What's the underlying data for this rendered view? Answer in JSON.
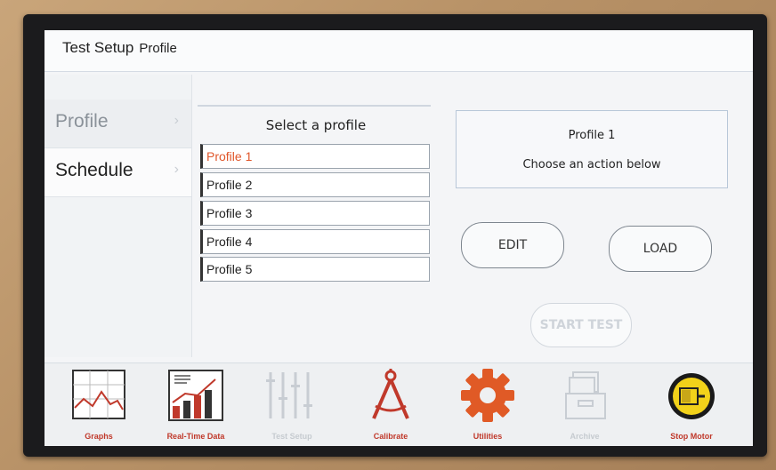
{
  "header": {
    "title": "Test Setup",
    "subtitle": "Profile"
  },
  "sidebar": {
    "items": [
      {
        "label": "Profile",
        "state": "active"
      },
      {
        "label": "Schedule",
        "state": "normal"
      }
    ]
  },
  "profiles": {
    "title": "Select a profile",
    "items": [
      "Profile 1",
      "Profile 2",
      "Profile 3",
      "Profile 4",
      "Profile 5"
    ],
    "selected": "Profile 1"
  },
  "info": {
    "line1": "Profile 1",
    "line2": "Choose an action below"
  },
  "actions": {
    "edit": "EDIT",
    "load": "LOAD",
    "start": "START TEST"
  },
  "toolbar": {
    "graphs": "Graphs",
    "realtime": "Real-Time Data",
    "testsetup": "Test Setup",
    "calibrate": "Calibrate",
    "utilities": "Utilities",
    "archive": "Archive",
    "stopmotor": "Stop Motor"
  },
  "colors": {
    "accent": "#e0572b",
    "label_red": "#c0392b",
    "disabled": "#c6cbd0"
  }
}
